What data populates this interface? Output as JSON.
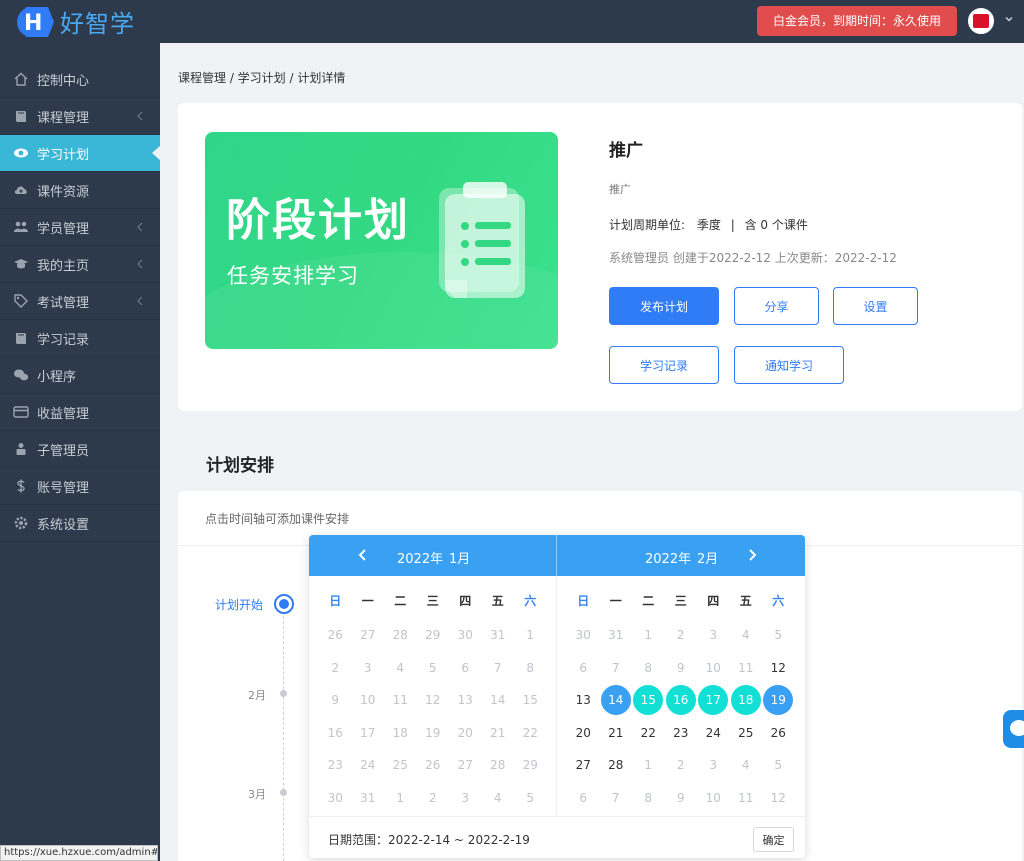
{
  "header": {
    "logo_text": "好智学",
    "logo_letter": "H",
    "member_badge": "白金会员，到期时间：永久使用"
  },
  "sidebar": {
    "items": [
      {
        "label": "控制中心",
        "icon": "home-icon",
        "has_children": false,
        "active": false
      },
      {
        "label": "课程管理",
        "icon": "book-icon",
        "has_children": true,
        "active": false
      },
      {
        "label": "学习计划",
        "icon": "eye-icon",
        "has_children": false,
        "active": true
      },
      {
        "label": "课件资源",
        "icon": "cloud-upload-icon",
        "has_children": false,
        "active": false
      },
      {
        "label": "学员管理",
        "icon": "users-icon",
        "has_children": true,
        "active": false
      },
      {
        "label": "我的主页",
        "icon": "graduation-cap-icon",
        "has_children": true,
        "active": false
      },
      {
        "label": "考试管理",
        "icon": "tag-icon",
        "has_children": true,
        "active": false
      },
      {
        "label": "学习记录",
        "icon": "book-icon",
        "has_children": false,
        "active": false
      },
      {
        "label": "小程序",
        "icon": "wechat-icon",
        "has_children": false,
        "active": false
      },
      {
        "label": "收益管理",
        "icon": "credit-card-icon",
        "has_children": false,
        "active": false
      },
      {
        "label": "子管理员",
        "icon": "user-lock-icon",
        "has_children": false,
        "active": false
      },
      {
        "label": "账号管理",
        "icon": "dollar-icon",
        "has_children": false,
        "active": false
      },
      {
        "label": "系统设置",
        "icon": "gear-icon",
        "has_children": false,
        "active": false
      }
    ]
  },
  "breadcrumb": "课程管理 / 学习计划 / 计划详情",
  "plan": {
    "banner_title": "阶段计划",
    "banner_subtitle": "任务安排学习",
    "title": "推广",
    "description": "推广",
    "period_label": "计划周期单位:",
    "period_value": "季度",
    "separator": "|",
    "course_count": "含 0 个课件",
    "creator_line": "系统管理员 创建于2022-2-12 上次更新：2022-2-12"
  },
  "actions": {
    "publish": "发布计划",
    "share": "分享",
    "settings": "设置",
    "records": "学习记录",
    "notify": "通知学习"
  },
  "schedule": {
    "section_title": "计划安排",
    "hint": "点击时间轴可添加课件安排",
    "timeline_start": "计划开始",
    "months": [
      "2月",
      "3月"
    ]
  },
  "datepicker": {
    "weekdays": [
      "日",
      "一",
      "二",
      "三",
      "四",
      "五",
      "六"
    ],
    "left": {
      "year_label": "2022年",
      "month_label": "1月",
      "weeks": [
        [
          [
            "26",
            "m"
          ],
          [
            "27",
            "m"
          ],
          [
            "28",
            "m"
          ],
          [
            "29",
            "m"
          ],
          [
            "30",
            "m"
          ],
          [
            "31",
            "m"
          ],
          [
            "1",
            "m"
          ]
        ],
        [
          [
            "2",
            "m"
          ],
          [
            "3",
            "m"
          ],
          [
            "4",
            "m"
          ],
          [
            "5",
            "m"
          ],
          [
            "6",
            "m"
          ],
          [
            "7",
            "m"
          ],
          [
            "8",
            "m"
          ]
        ],
        [
          [
            "9",
            "m"
          ],
          [
            "10",
            "m"
          ],
          [
            "11",
            "m"
          ],
          [
            "12",
            "m"
          ],
          [
            "13",
            "m"
          ],
          [
            "14",
            "m"
          ],
          [
            "15",
            "m"
          ]
        ],
        [
          [
            "16",
            "m"
          ],
          [
            "17",
            "m"
          ],
          [
            "18",
            "m"
          ],
          [
            "19",
            "m"
          ],
          [
            "20",
            "m"
          ],
          [
            "21",
            "m"
          ],
          [
            "22",
            "m"
          ]
        ],
        [
          [
            "23",
            "m"
          ],
          [
            "24",
            "m"
          ],
          [
            "25",
            "m"
          ],
          [
            "26",
            "m"
          ],
          [
            "27",
            "m"
          ],
          [
            "28",
            "m"
          ],
          [
            "29",
            "m"
          ]
        ],
        [
          [
            "30",
            "m"
          ],
          [
            "31",
            "m"
          ],
          [
            "1",
            "m"
          ],
          [
            "2",
            "m"
          ],
          [
            "3",
            "m"
          ],
          [
            "4",
            "m"
          ],
          [
            "5",
            "m"
          ]
        ]
      ]
    },
    "right": {
      "year_label": "2022年",
      "month_label": "2月",
      "weeks": [
        [
          [
            "30",
            "m"
          ],
          [
            "31",
            "m"
          ],
          [
            "1",
            "m"
          ],
          [
            "2",
            "m"
          ],
          [
            "3",
            "m"
          ],
          [
            "4",
            "m"
          ],
          [
            "5",
            "m"
          ]
        ],
        [
          [
            "6",
            "m"
          ],
          [
            "7",
            "m"
          ],
          [
            "8",
            "m"
          ],
          [
            "9",
            "m"
          ],
          [
            "10",
            "m"
          ],
          [
            "11",
            "m"
          ],
          [
            "12",
            "n"
          ]
        ],
        [
          [
            "13",
            "n"
          ],
          [
            "14",
            "e"
          ],
          [
            "15",
            "s"
          ],
          [
            "16",
            "s"
          ],
          [
            "17",
            "s"
          ],
          [
            "18",
            "s"
          ],
          [
            "19",
            "e"
          ]
        ],
        [
          [
            "20",
            "n"
          ],
          [
            "21",
            "n"
          ],
          [
            "22",
            "n"
          ],
          [
            "23",
            "n"
          ],
          [
            "24",
            "n"
          ],
          [
            "25",
            "n"
          ],
          [
            "26",
            "n"
          ]
        ],
        [
          [
            "27",
            "n"
          ],
          [
            "28",
            "n"
          ],
          [
            "1",
            "m"
          ],
          [
            "2",
            "m"
          ],
          [
            "3",
            "m"
          ],
          [
            "4",
            "m"
          ],
          [
            "5",
            "m"
          ]
        ],
        [
          [
            "6",
            "m"
          ],
          [
            "7",
            "m"
          ],
          [
            "8",
            "m"
          ],
          [
            "9",
            "m"
          ],
          [
            "10",
            "m"
          ],
          [
            "11",
            "m"
          ],
          [
            "12",
            "m"
          ]
        ]
      ]
    },
    "range_label": "日期范围：",
    "range_value": "2022-2-14 ~ 2022-2-19",
    "confirm": "确定"
  },
  "status_url": "https://xue.hzxue.com/admin#/",
  "colors": {
    "sidebar_bg": "#2d3a4b",
    "active_nav": "#3ab7d6",
    "primary": "#2f7cf6",
    "picker_header": "#3aa0f2",
    "range_fill": "#12e0d4",
    "badge_red": "#e14c4c",
    "banner_green": "#33d982"
  }
}
